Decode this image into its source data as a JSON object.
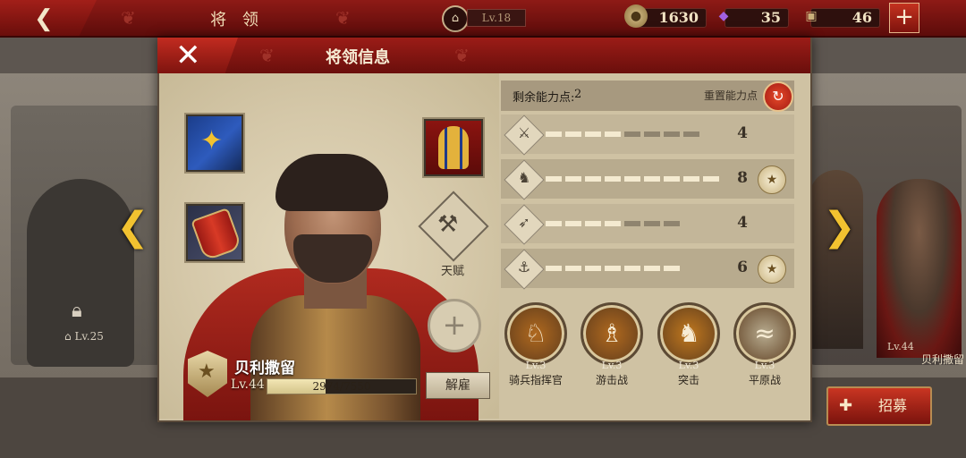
{
  "topbar": {
    "title": "将 领",
    "castle_level": "Lv.18",
    "gold": "1630",
    "gems": "35",
    "tokens": "46",
    "icons": {
      "back": "chevron-left-icon",
      "castle": "castle-icon",
      "gold": "coin-icon",
      "gems": "gem-icon",
      "tokens": "crate-icon",
      "add": "plus-icon"
    }
  },
  "modal": {
    "title": "将领信息",
    "talent_label": "天赋",
    "general": {
      "name": "贝利撒留",
      "level": "Lv.44",
      "xp": "2974/7550",
      "xp_fraction": 0.394
    },
    "dismiss_label": "解雇",
    "points": {
      "label": "剩余能力点:",
      "value": "2",
      "reset_label": "重置能力点"
    },
    "stats": [
      {
        "icon": "sword-icon",
        "glyph": "⚔",
        "value": "4",
        "filled": 4,
        "total": 8,
        "medal": false
      },
      {
        "icon": "horse-icon",
        "glyph": "♞",
        "value": "8",
        "filled": 9,
        "total": 9,
        "medal": true
      },
      {
        "icon": "bow-icon",
        "glyph": "➶",
        "value": "4",
        "filled": 4,
        "total": 7,
        "medal": false
      },
      {
        "icon": "anchor-icon",
        "glyph": "⚓",
        "value": "6",
        "filled": 7,
        "total": 7,
        "medal": true
      }
    ],
    "skills": [
      {
        "level": "Lv.3",
        "name": "骑兵指挥官",
        "icon": "horse-head-icon",
        "glyph": "♘",
        "color": "#b0691f"
      },
      {
        "level": "Lv.3",
        "name": "游击战",
        "icon": "skirmishers-icon",
        "glyph": "♗",
        "color": "#b0691f"
      },
      {
        "level": "Lv.3",
        "name": "突击",
        "icon": "cavalry-charge-icon",
        "glyph": "♞",
        "color": "#c0781f"
      },
      {
        "level": "Lv.3",
        "name": "平原战",
        "icon": "plains-icon",
        "glyph": "≈",
        "color": "#b7ab8f"
      }
    ]
  },
  "side_cards": {
    "left_level": "Lv.25",
    "right_name": "贝利撒留",
    "right_level": "Lv.44"
  },
  "recruit_label": "招募",
  "colors": {
    "header_red": "#8e1a16",
    "accent_gold": "#f2c230",
    "panel_bg": "#cfc2a3"
  }
}
